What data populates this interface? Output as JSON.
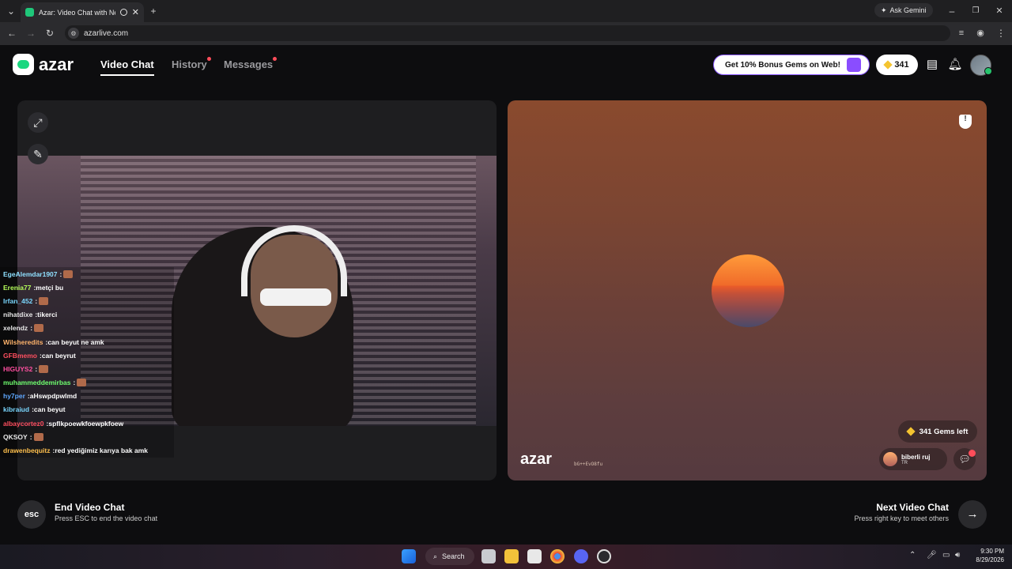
{
  "browser": {
    "tab_title": "Azar: Video Chat with New",
    "address": "azarlive.com",
    "ask_gemini": "Ask Gemini"
  },
  "header": {
    "logo_text": "azar",
    "nav": [
      {
        "label": "Video Chat",
        "active": true,
        "dot": false
      },
      {
        "label": "History",
        "active": false,
        "dot": true
      },
      {
        "label": "Messages",
        "active": false,
        "dot": true
      }
    ],
    "bonus_label": "Get 10% Bonus Gems on Web!",
    "gems_count": "341"
  },
  "left_video": {
    "chat": [
      {
        "user": "EgeAlemdar1907",
        "msg": "",
        "user_color": "#8fe0ff",
        "emote": true
      },
      {
        "user": "Erenia77",
        "msg": "metçi bu",
        "user_color": "#b6ff5a",
        "emote": false
      },
      {
        "user": "Irfan_452",
        "msg": "",
        "user_color": "#7ad7ff",
        "emote": true
      },
      {
        "user": "nihatdixe",
        "msg": "tikerci",
        "user_color": "#e8e8e8",
        "emote": false
      },
      {
        "user": "xelendz",
        "msg": "",
        "user_color": "#e8e8e8",
        "emote": true
      },
      {
        "user": "Wilsheredits",
        "msg": "can beyut ne amk",
        "user_color": "#ffb36b",
        "emote": false
      },
      {
        "user": "GFBmemo",
        "msg": "can beyrut",
        "user_color": "#ff4f5f",
        "emote": false
      },
      {
        "user": "HIGUYS2",
        "msg": "",
        "user_color": "#ff4fa0",
        "emote": true
      },
      {
        "user": "muhammeddemirbas",
        "msg": "",
        "user_color": "#6fff6f",
        "emote": true
      },
      {
        "user": "hy7per",
        "msg": "aHswpdpwlmd",
        "user_color": "#5fa8ff",
        "emote": false
      },
      {
        "user": "kibraiud",
        "msg": "can beyut",
        "user_color": "#7ad7ff",
        "emote": false
      },
      {
        "user": "albaycortez0",
        "msg": "spflkpoewkfoewpkfoew",
        "user_color": "#ff4f5f",
        "emote": false
      },
      {
        "user": "QKSOY",
        "msg": "",
        "user_color": "#e8e8e8",
        "emote": true
      },
      {
        "user": "drawenbequitz",
        "msg": "red yediğimiz karıya bak amk",
        "user_color": "#ffc04d",
        "emote": false
      }
    ]
  },
  "right_video": {
    "gems_left": "341 Gems left",
    "peer_name": "biberli ruj",
    "peer_country": "TR",
    "watermark": "azar",
    "watermark_code": "bG++EvO8fu"
  },
  "controls": {
    "esc_key": "esc",
    "end_title": "End Video Chat",
    "end_sub": "Press ESC to end the video chat",
    "next_title": "Next Video Chat",
    "next_sub": "Press right key to meet others"
  },
  "taskbar": {
    "search_label": "Search",
    "time": "9:30 PM",
    "date": "8/29/2026"
  },
  "colors": {
    "accent_green": "#1ad77f",
    "notify_red": "#ff4d5a",
    "gem_gold": "#f4c430",
    "bonus_border": "#8a58ff"
  }
}
